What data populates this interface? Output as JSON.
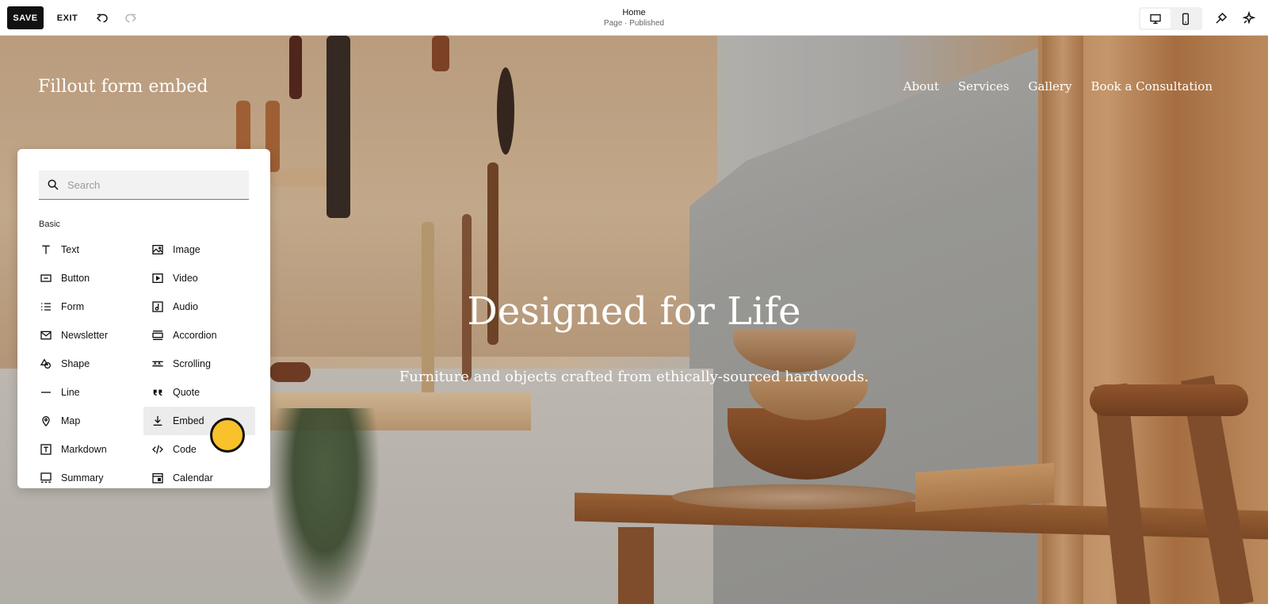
{
  "toolbar": {
    "save_label": "SAVE",
    "exit_label": "EXIT",
    "undo_icon": "undo-icon",
    "redo_icon": "redo-icon",
    "page_name": "Home",
    "page_status": "Page · Published",
    "desktop_icon": "desktop-icon",
    "mobile_icon": "mobile-icon",
    "design_icon": "paintbrush-icon",
    "ai_icon": "sparkle-icon"
  },
  "site": {
    "title": "Fillout form embed",
    "nav": [
      "About",
      "Services",
      "Gallery",
      "Book a Consultation"
    ],
    "hero_heading": "Designed for Life",
    "hero_subheading": "Furniture and objects crafted from ethically-sourced hardwoods."
  },
  "block_panel": {
    "search_placeholder": "Search",
    "section": "Basic",
    "items": [
      {
        "label": "Text",
        "icon": "text-icon"
      },
      {
        "label": "Image",
        "icon": "image-icon"
      },
      {
        "label": "Button",
        "icon": "button-icon"
      },
      {
        "label": "Video",
        "icon": "video-icon"
      },
      {
        "label": "Form",
        "icon": "form-icon"
      },
      {
        "label": "Audio",
        "icon": "audio-icon"
      },
      {
        "label": "Newsletter",
        "icon": "newsletter-icon"
      },
      {
        "label": "Accordion",
        "icon": "accordion-icon"
      },
      {
        "label": "Shape",
        "icon": "shape-icon"
      },
      {
        "label": "Scrolling",
        "icon": "scrolling-icon"
      },
      {
        "label": "Line",
        "icon": "line-icon"
      },
      {
        "label": "Quote",
        "icon": "quote-icon"
      },
      {
        "label": "Map",
        "icon": "map-pin-icon"
      },
      {
        "label": "Embed",
        "icon": "embed-icon"
      },
      {
        "label": "Markdown",
        "icon": "markdown-icon"
      },
      {
        "label": "Code",
        "icon": "code-icon"
      },
      {
        "label": "Summary",
        "icon": "summary-icon"
      },
      {
        "label": "Calendar",
        "icon": "calendar-icon"
      }
    ],
    "highlighted": "Embed"
  },
  "colors": {
    "save_bg": "#111111",
    "cursor_highlight": "#f9c12a",
    "hover_bg": "#ececec"
  }
}
